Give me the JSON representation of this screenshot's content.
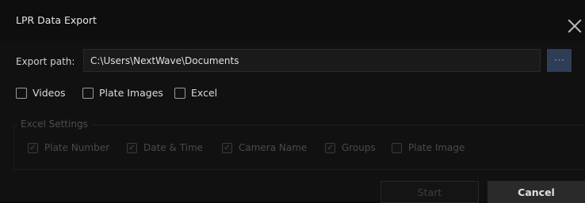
{
  "dialog": {
    "title": "LPR Data Export",
    "close_icon": "close-icon"
  },
  "export_path": {
    "label": "Export path:",
    "value": "C:\\Users\\NextWave\\Documents",
    "browse_label": "···"
  },
  "options": [
    {
      "label": "Videos",
      "checked": false
    },
    {
      "label": "Plate Images",
      "checked": false
    },
    {
      "label": "Excel",
      "checked": false
    }
  ],
  "excel_settings": {
    "title": "Excel Settings",
    "enabled": false,
    "items": [
      {
        "label": "Plate Number",
        "checked": true
      },
      {
        "label": "Date & Time",
        "checked": true
      },
      {
        "label": "Camera Name",
        "checked": true
      },
      {
        "label": "Groups",
        "checked": true
      },
      {
        "label": "Plate Image",
        "checked": false
      }
    ]
  },
  "buttons": {
    "start": "Start",
    "cancel": "Cancel"
  },
  "colors": {
    "background": "#111111",
    "titlebar": "#0e0e0e",
    "accent_button": "#2e3e56",
    "cancel_button": "#2a2a2a"
  }
}
